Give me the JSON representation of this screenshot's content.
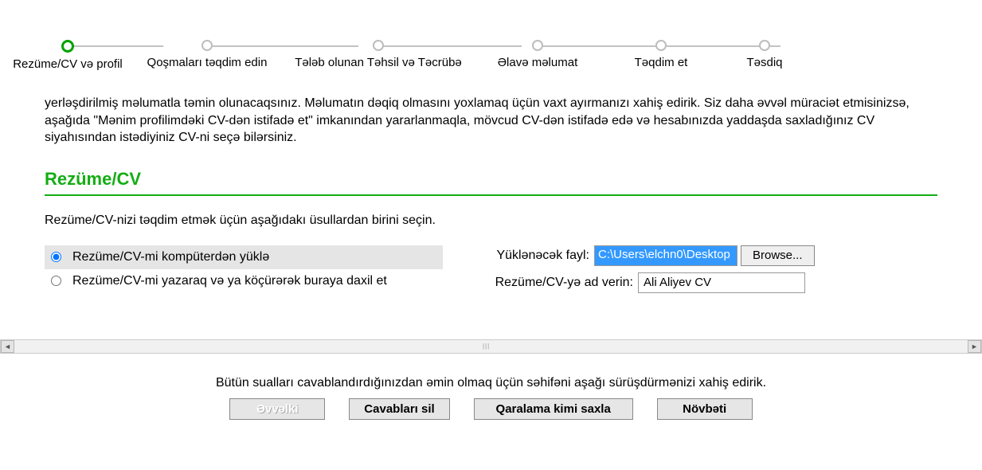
{
  "stepper": {
    "steps": [
      {
        "label": "Rezüme/CV və profil",
        "active": true
      },
      {
        "label": "Qoşmaları təqdim edin",
        "active": false
      },
      {
        "label": "Tələb olunan Təhsil və Təcrübə",
        "active": false
      },
      {
        "label": "Əlavə məlumat",
        "active": false
      },
      {
        "label": "Təqdim et",
        "active": false
      },
      {
        "label": "Təsdiq",
        "active": false
      }
    ]
  },
  "intro_text": "yerləşdirilmiş məlumatla təmin olunacaqsınız. Məlumatın dəqiq olmasını yoxlamaq üçün vaxt ayırmanızı xahiş edirik. Siz daha əvvəl müraciət etmisinizsə, aşağıda \"Mənim profilimdəki CV-dən istifadə et\" imkanından yararlanmaqla, mövcud CV-dən istifadə edə və hesabınızda yaddaşda saxladığınız CV siyahısından istədiyiniz CV-ni seçə bilərsiniz.",
  "section": {
    "title": "Rezüme/CV",
    "subtitle": "Rezüme/CV-nizi təqdim etmək üçün aşağıdakı üsullardan birini seçin."
  },
  "radios": {
    "upload_label": "Rezüme/CV-mi kompüterdən yüklə",
    "paste_label": "Rezüme/CV-mi yazaraq və ya köçürərək buraya daxil et"
  },
  "fields": {
    "file_label": "Yüklənəcək fayl:",
    "file_value": "C:\\Users\\elchn0\\Desktop",
    "browse_label": "Browse...",
    "name_label": "Rezüme/CV-yə ad verin:",
    "name_value": "Ali Aliyev CV"
  },
  "footer": {
    "note": "Bütün sualları cavablandırdığınızdan əmin olmaq üçün səhifəni aşağı sürüşdürmənizi xahiş edirik.",
    "buttons": {
      "prev": "Əvvəlki",
      "clear": "Cavabları sil",
      "draft": "Qaralama kimi saxla",
      "next": "Növbəti"
    }
  }
}
